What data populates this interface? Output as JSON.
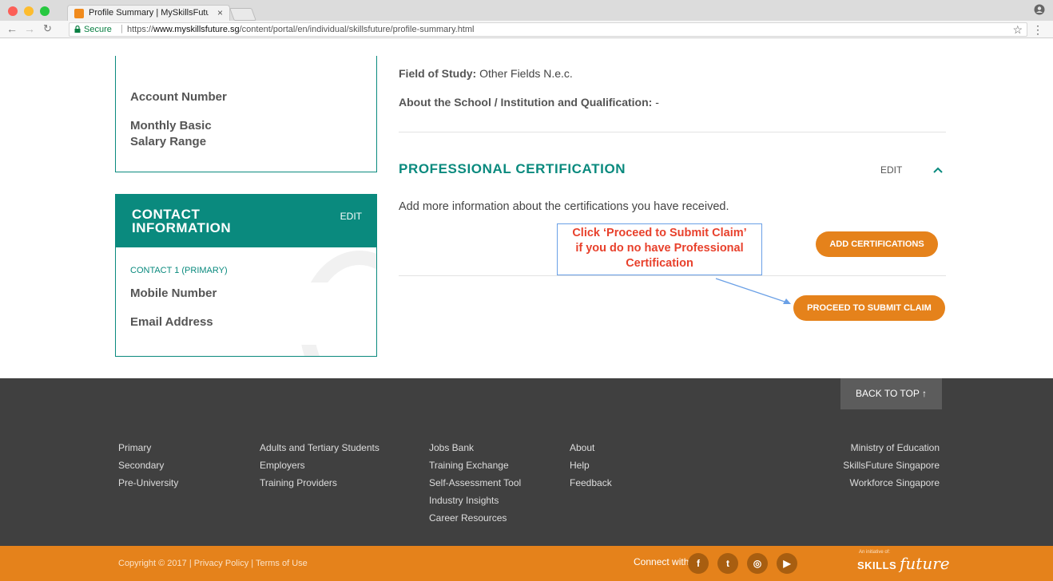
{
  "browser": {
    "tab_title": "Profile Summary | MySkillsFutu",
    "tab_close": "×",
    "secure_label": "Secure",
    "url_prefix": "https://",
    "url_domain": "www.myskillsfuture.sg",
    "url_path": "/content/portal/en/individual/skillsfuture/profile-summary.html",
    "traffic_colors": [
      "#fc5f57",
      "#fdbc2e",
      "#27c840"
    ],
    "icons": [
      "back-icon",
      "forward-icon",
      "reload-icon",
      "lock-icon",
      "star-icon",
      "menu-icon",
      "profile-icon"
    ]
  },
  "left_panel": {
    "account_number_label": "Account Number",
    "salary_label_line1": "Monthly Basic",
    "salary_label_line2": "Salary Range"
  },
  "contact": {
    "title_line1": "CONTACT",
    "title_line2": "INFORMATION",
    "edit_label": "EDIT",
    "contact_sub": "CONTACT 1  (PRIMARY)",
    "mobile_label": "Mobile Number",
    "email_label": "Email Address"
  },
  "education": {
    "field_of_study_label": "Field of Study:",
    "field_of_study_value": "Other Fields N.e.c.",
    "about_label": "About the School / Institution and Qualification:",
    "about_value": "-"
  },
  "certification": {
    "title": "PROFESSIONAL CERTIFICATION",
    "edit_label": "EDIT",
    "description": "Add more information about the certifications you have received.",
    "add_button": "ADD CERTIFICATIONS",
    "proceed_button": "PROCEED TO SUBMIT CLAIM"
  },
  "annotation": {
    "callout_line1": "Click ‘Proceed to Submit Claim’",
    "callout_line2": "if you do no have Professional",
    "callout_line3": "Certification",
    "border_color": "#6aa0e6",
    "text_color": "#e8412c"
  },
  "footer": {
    "back_to_top": "BACK TO TOP ↑",
    "col1": [
      "Primary",
      "Secondary",
      "Pre-University"
    ],
    "col2": [
      "Adults and Tertiary Students",
      "Employers",
      "Training Providers"
    ],
    "col3": [
      "Jobs Bank",
      "Training Exchange",
      "Self-Assessment Tool",
      "Industry Insights",
      "Career Resources"
    ],
    "col4": [
      "About",
      "Help",
      "Feedback"
    ],
    "col5": [
      "Ministry of Education",
      "SkillsFuture Singapore",
      "Workforce Singapore"
    ],
    "copyright_text": "Copyright © 2017 | Privacy Policy | Terms of Use",
    "connect_with": "Connect with",
    "social": [
      "f",
      "t",
      "◎",
      "▶"
    ],
    "initiative": "An initiative of:",
    "brand_skills": "SKILLS",
    "brand_future": "future"
  },
  "colors": {
    "teal": "#0a8a7e",
    "orange": "#e5821b",
    "footer_dark": "#404040"
  }
}
